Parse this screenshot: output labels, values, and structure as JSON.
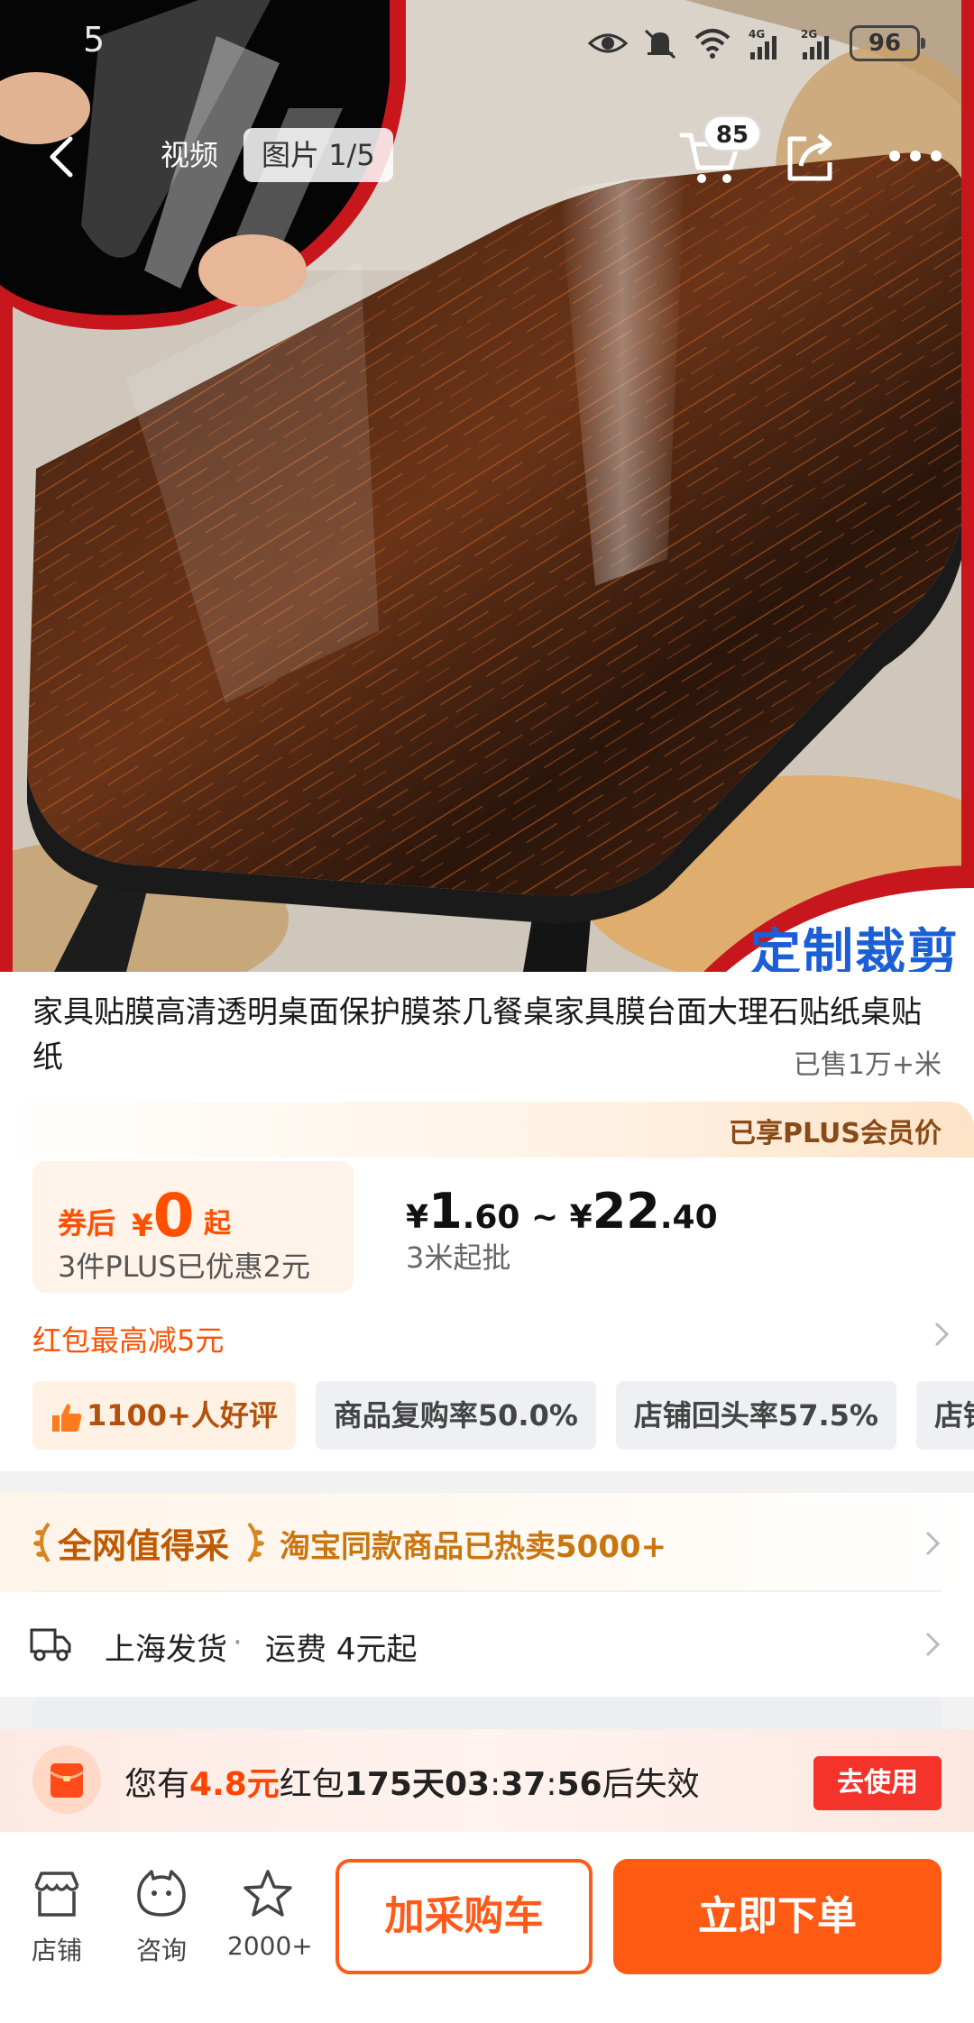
{
  "status_bar": {
    "time": "5",
    "network_4g": "4G",
    "network_2g": "2G",
    "battery": "96"
  },
  "top_nav": {
    "tab_video": "视频",
    "tab_images": "图片 1/5",
    "cart_count": "85"
  },
  "hero": {
    "overlay_text": "定制裁剪"
  },
  "product": {
    "title": "家具贴膜高清透明桌面保护膜茶几餐桌家具膜台面大理石贴纸桌贴纸",
    "sold": "已售1万+米"
  },
  "price": {
    "plus_member": "已享PLUS会员价",
    "after_coupon_label": "券后",
    "currency": "¥",
    "after_coupon_value": "0",
    "after_coupon_suffix": "起",
    "plus_saving": "3件PLUS已优惠2元",
    "range_currency_a": "¥",
    "range_low_int": "1",
    "range_low_dec": ".60",
    "range_sep": " ~ ",
    "range_currency_b": "¥",
    "range_high_int": "22",
    "range_high_dec": ".40",
    "min_order": "3米起批",
    "red_packet": "红包最高减5元"
  },
  "tags": [
    {
      "label": "1100+人好评"
    },
    {
      "label": "商品复购率50.0%"
    },
    {
      "label": "店铺回头率57.5%"
    },
    {
      "label": "店铺"
    }
  ],
  "worth": {
    "title": "全网值得采",
    "desc": "淘宝同款商品已热卖5000+"
  },
  "shipping": {
    "origin": "上海发货",
    "dot": "·",
    "fee": "运费 4元起"
  },
  "red_banner": {
    "prefix": "您有",
    "amount": "4.8元",
    "mid": "红包",
    "days": "175天",
    "time_h": "03",
    "colon1": ":",
    "time_m": "37",
    "colon2": ":",
    "time_s": "56",
    "suffix": "后失效",
    "button": "去使用"
  },
  "bottom_bar": {
    "store": "店铺",
    "consult": "咨询",
    "favorites": "2000+",
    "add_cart": "加采购车",
    "buy_now": "立即下单"
  },
  "colors": {
    "accent": "#ff5000",
    "buy_button": "#ff5a14",
    "use_button": "#f4332a",
    "overlay_blue": "#1a5fd6"
  }
}
